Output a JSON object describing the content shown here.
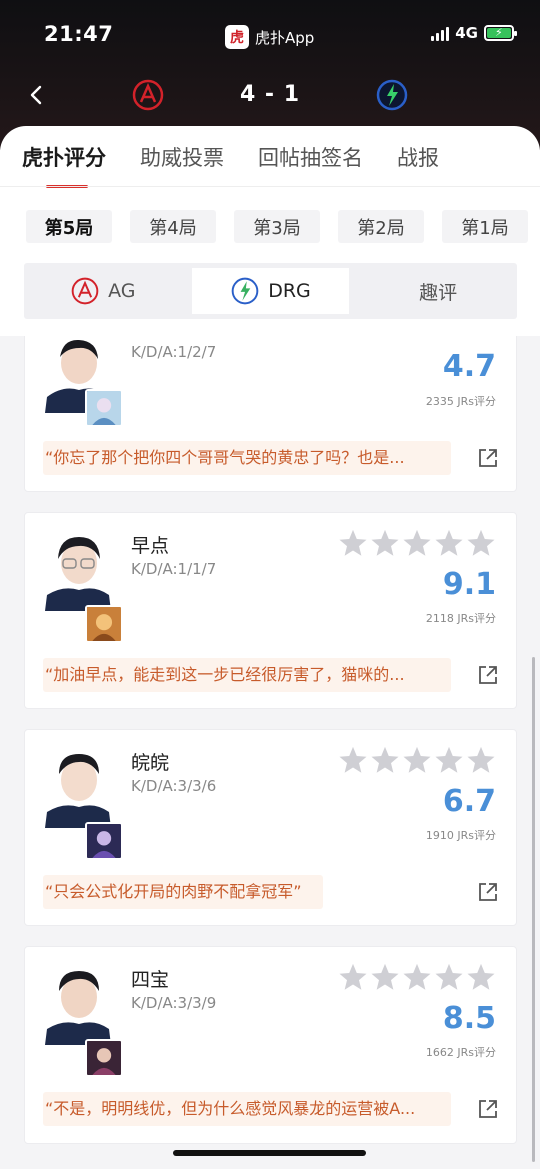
{
  "status": {
    "time": "21:47",
    "app_name": "虎扑App",
    "app_logo_char": "虎",
    "network": "4G"
  },
  "match": {
    "score": "4 - 1",
    "team_a": "AG",
    "team_b": "DRG"
  },
  "tabs": [
    {
      "label": "虎扑评分",
      "active": true
    },
    {
      "label": "助威投票",
      "active": false
    },
    {
      "label": "回帖抽签名",
      "active": false
    },
    {
      "label": "战报",
      "active": false
    }
  ],
  "games": [
    "第5局",
    "第4局",
    "第3局",
    "第2局",
    "第1局"
  ],
  "team_tabs": [
    {
      "label": "AG",
      "active": false
    },
    {
      "label": "DRG",
      "active": true
    },
    {
      "label": "趣评",
      "active": false
    }
  ],
  "players": [
    {
      "name": "",
      "kda": "K/D/A:1/2/7",
      "score": "4.7",
      "votes": "2335 JRs评分",
      "quote": "“你忘了那个把你四个哥哥气哭的黄忠了吗？也是..."
    },
    {
      "name": "早点",
      "kda": "K/D/A:1/1/7",
      "score": "9.1",
      "votes": "2118 JRs评分",
      "quote": "“加油早点，能走到这一步已经很厉害了，猫咪的..."
    },
    {
      "name": "皖皖",
      "kda": "K/D/A:3/3/6",
      "score": "6.7",
      "votes": "1910 JRs评分",
      "quote": "“只会公式化开局的肉野不配拿冠军”"
    },
    {
      "name": "四宝",
      "kda": "K/D/A:3/3/9",
      "score": "8.5",
      "votes": "1662 JRs评分",
      "quote": "“不是，明明线优，但为什么感觉风暴龙的运营被A..."
    }
  ],
  "colors": {
    "accent": "#d9302c",
    "score_blue": "#4a8fd7",
    "quote_text": "#c75b2b",
    "quote_bg": "#fdf3ec",
    "star": "#cfcfd4"
  }
}
